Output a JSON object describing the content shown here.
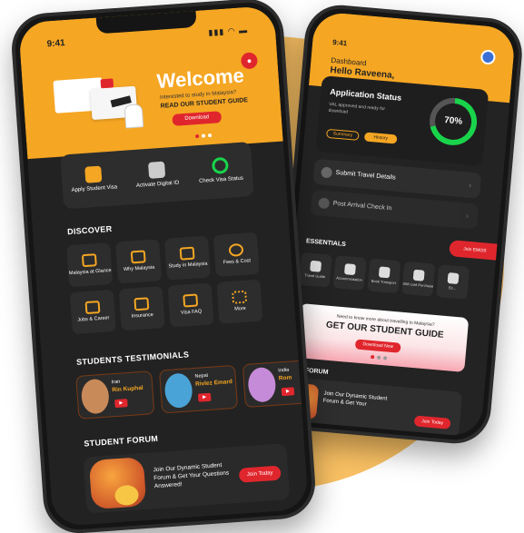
{
  "colors": {
    "accent": "#f5a623",
    "danger": "#e0262d",
    "success": "#19d44b",
    "dark": "#222222"
  },
  "back": {
    "time": "9:41",
    "dashboard": "Dashboard",
    "hello": "Hello Raveena,",
    "status": {
      "title": "Application Status",
      "note": "VAL approved and ready for download",
      "summary": "Summary",
      "history": "History",
      "percent": "70%",
      "progress": 0.7
    },
    "rows": [
      "Submit Travel Details",
      "Post Arrival Check In"
    ],
    "join": "Join EMGS",
    "essentials_title": "ESSENTIALS",
    "essentials": [
      "Travel Guide",
      "Accommodation",
      "Book Transport",
      "SIM card Purchase",
      "Ex..."
    ],
    "banner": {
      "question": "Need to know more about travelling to Malaysia?",
      "title": "GET OUR STUDENT GUIDE",
      "button": "Download Now"
    },
    "forum_title": "NT FORUM",
    "forum_text": "Join Our Dynamic Student Forum & Get Your",
    "forum_button": "Join Today"
  },
  "front": {
    "time": "9:41",
    "system_icons": "▮▮▮ ◠ ▬",
    "welcome": "Welcome",
    "interested": "Interested to study in Malaysia?",
    "read_guide": "READ OUR STUDENT GUIDE",
    "download": "Download",
    "quick": [
      {
        "label": "Apply Student Visa",
        "icon": "passport-icon",
        "color": "#f5a623"
      },
      {
        "label": "Activate Digital ID",
        "icon": "qr-icon",
        "color": "#cccccc"
      },
      {
        "label": "Check Visa Status",
        "icon": "progress-ring-icon",
        "color": "#19d44b"
      }
    ],
    "discover_title": "DISCOVER",
    "discover": [
      "Malaysia at Glance",
      "Why Malaysia",
      "Study in Malaysia",
      "Fees & Cost",
      "Jobs & Career",
      "Insurance",
      "Visa FAQ",
      "More"
    ],
    "testimonials_title": "STUDENTS TESTIMONIALS",
    "testimonials": [
      {
        "country": "Iran",
        "name": "Rin Kuphal",
        "color": "#c98a5a"
      },
      {
        "country": "Nepal",
        "name": "Rivlez Emard",
        "color": "#4aa3d6"
      },
      {
        "country": "India",
        "name": "Rom",
        "color": "#c58bd8"
      }
    ],
    "forum_title": "STUDENT FORUM",
    "forum_text": "Join Our Dynamic Student Forum & Get Your Questions Answered!",
    "forum_button": "Join Today"
  }
}
